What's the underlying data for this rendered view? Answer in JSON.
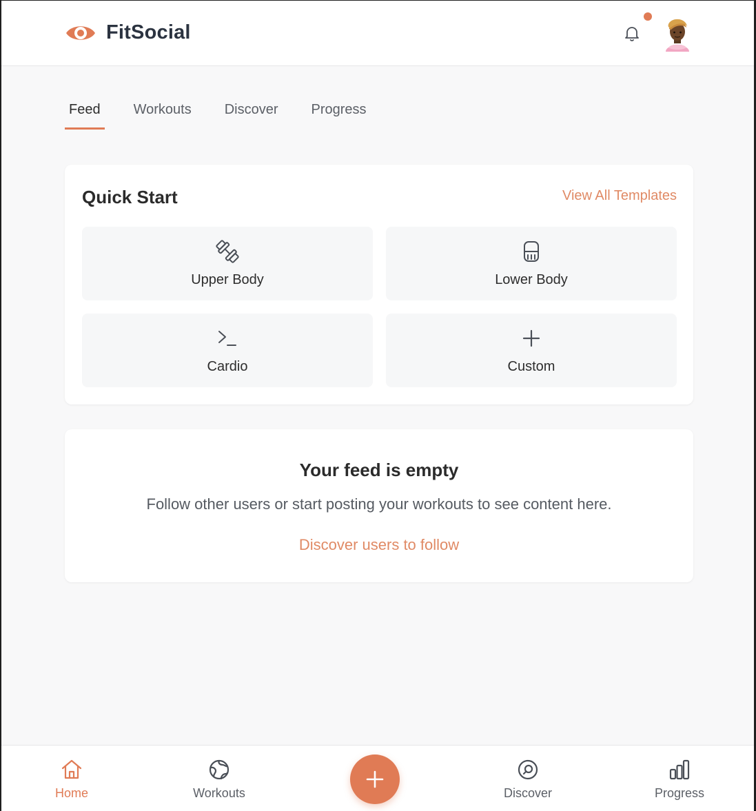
{
  "app": {
    "name": "FitSocial",
    "logo_icon": "eye-icon"
  },
  "header": {
    "notification_icon": "bell-icon",
    "has_unread": true,
    "avatar_icon": "avatar"
  },
  "tabs": [
    {
      "label": "Feed",
      "active": true
    },
    {
      "label": "Workouts",
      "active": false
    },
    {
      "label": "Discover",
      "active": false
    },
    {
      "label": "Progress",
      "active": false
    }
  ],
  "quick_start": {
    "title": "Quick Start",
    "link": "View All Templates",
    "tiles": [
      {
        "label": "Upper Body",
        "icon": "dumbbell-icon"
      },
      {
        "label": "Lower Body",
        "icon": "kettlebell-icon"
      },
      {
        "label": "Cardio",
        "icon": "terminal-icon"
      },
      {
        "label": "Custom",
        "icon": "plus-icon"
      }
    ]
  },
  "feed": {
    "empty_title": "Your feed is empty",
    "empty_message": "Follow other users or start posting your workouts to see content here.",
    "cta": "Discover users to follow"
  },
  "bottom_nav": {
    "items": [
      {
        "label": "Home",
        "icon": "home-icon",
        "active": true
      },
      {
        "label": "Workouts",
        "icon": "globe-icon",
        "active": false
      },
      {
        "label": "Discover",
        "icon": "compass-icon",
        "active": false
      },
      {
        "label": "Progress",
        "icon": "bar-chart-icon",
        "active": false
      }
    ],
    "fab_icon": "plus-icon"
  },
  "colors": {
    "accent": "#e07b55",
    "link": "#e08a65",
    "text": "#2d2d2d",
    "muted": "#5b5f66",
    "background": "#f8f8f9"
  }
}
